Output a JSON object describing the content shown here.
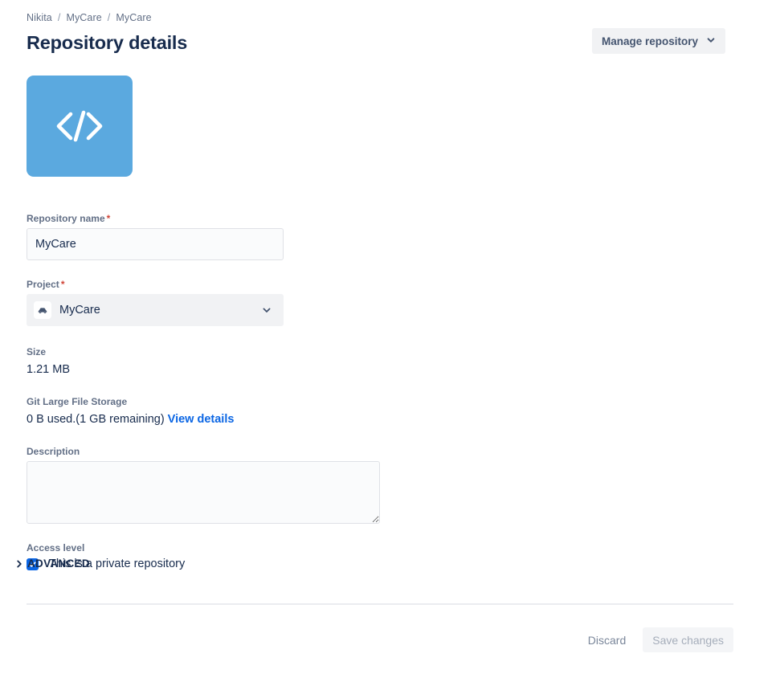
{
  "breadcrumb": {
    "items": [
      "Nikita",
      "MyCare",
      "MyCare"
    ],
    "separator": "/"
  },
  "header": {
    "title": "Repository details",
    "manage_button": {
      "label": "Manage repository",
      "icon": "chevron-down-icon"
    }
  },
  "avatar": {
    "icon": "code-brackets-icon",
    "background_color": "#5ba9df"
  },
  "form": {
    "repository_name": {
      "label": "Repository name",
      "required_marker": "*",
      "value": "MyCare",
      "placeholder": ""
    },
    "project": {
      "label": "Project",
      "required_marker": "*",
      "value": "MyCare",
      "avatar_icon": "car-icon",
      "chevron_icon": "chevron-down-icon"
    },
    "size": {
      "label": "Size",
      "value": "1.21 MB"
    },
    "git_lfs": {
      "label": "Git Large File Storage",
      "usage_text": "0 B used.(1 GB remaining)",
      "link_label": "View details",
      "link_color": "#0b66e4"
    },
    "description": {
      "label": "Description",
      "value": "",
      "placeholder": ""
    },
    "access_level": {
      "label": "Access level",
      "checkbox_label": "This is a private repository",
      "checked": true,
      "checkbox_color": "#0c66e4"
    }
  },
  "advanced": {
    "label": "ADVANCED",
    "icon": "chevron-right-icon",
    "expanded": false
  },
  "footer": {
    "discard_label": "Discard",
    "save_label": "Save changes",
    "save_disabled": true
  }
}
